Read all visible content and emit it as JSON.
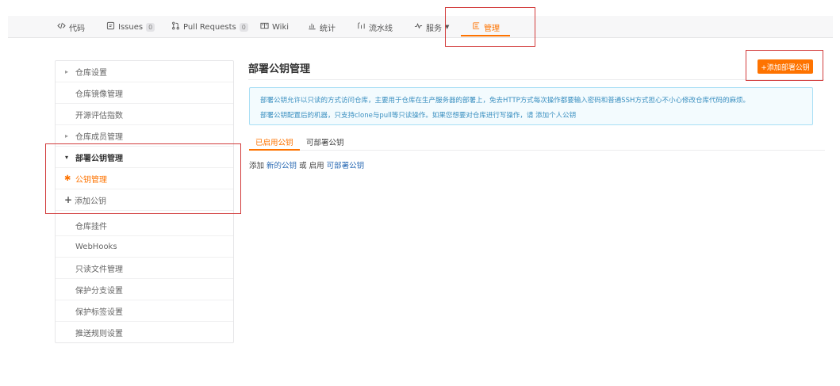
{
  "nav": {
    "code": "代码",
    "issues": "Issues",
    "issues_count": "0",
    "pull_requests": "Pull Requests",
    "pr_count": "0",
    "wiki": "Wiki",
    "stats": "统计",
    "pipeline": "流水线",
    "services": "服务",
    "manage": "管理"
  },
  "sidebar": {
    "repo_settings": "仓库设置",
    "repo_mirror": "仓库镜像管理",
    "oss_eval": "开源评估指数",
    "repo_members": "仓库成员管理",
    "deploy_keys_group": "部署公钥管理",
    "key_manage": "公钥管理",
    "add_key": "添加公钥",
    "repo_plugins": "仓库挂件",
    "webhooks": "WebHooks",
    "readonly_files": "只读文件管理",
    "protected_branches": "保护分支设置",
    "protected_tags": "保护标签设置",
    "push_rules": "推送规则设置"
  },
  "main": {
    "title": "部署公钥管理",
    "add_button": "+添加部署公钥",
    "info_line1": "部署公钥允许以只读的方式访问仓库，主要用于仓库在生产服务器的部署上，免去HTTP方式每次操作都要输入密码和普通SSH方式担心不小心修改仓库代码的麻烦。",
    "info_line2": "部署公钥配置后的机器，只支持clone与pull等只读操作。如果您想要对仓库进行写操作，请 添加个人公钥",
    "tab_enabled": "已启用公钥",
    "tab_deployable": "可部署公钥",
    "hint_prefix": "添加",
    "hint_new_key": "新的公钥",
    "hint_middle": "或 启用",
    "hint_deployable": "可部署公钥"
  },
  "colors": {
    "accent": "#fe7300",
    "info_text": "#3a8fc0",
    "info_bg": "#f3fbfe",
    "link": "#2d6cb5",
    "annotation": "#d23c3c"
  }
}
